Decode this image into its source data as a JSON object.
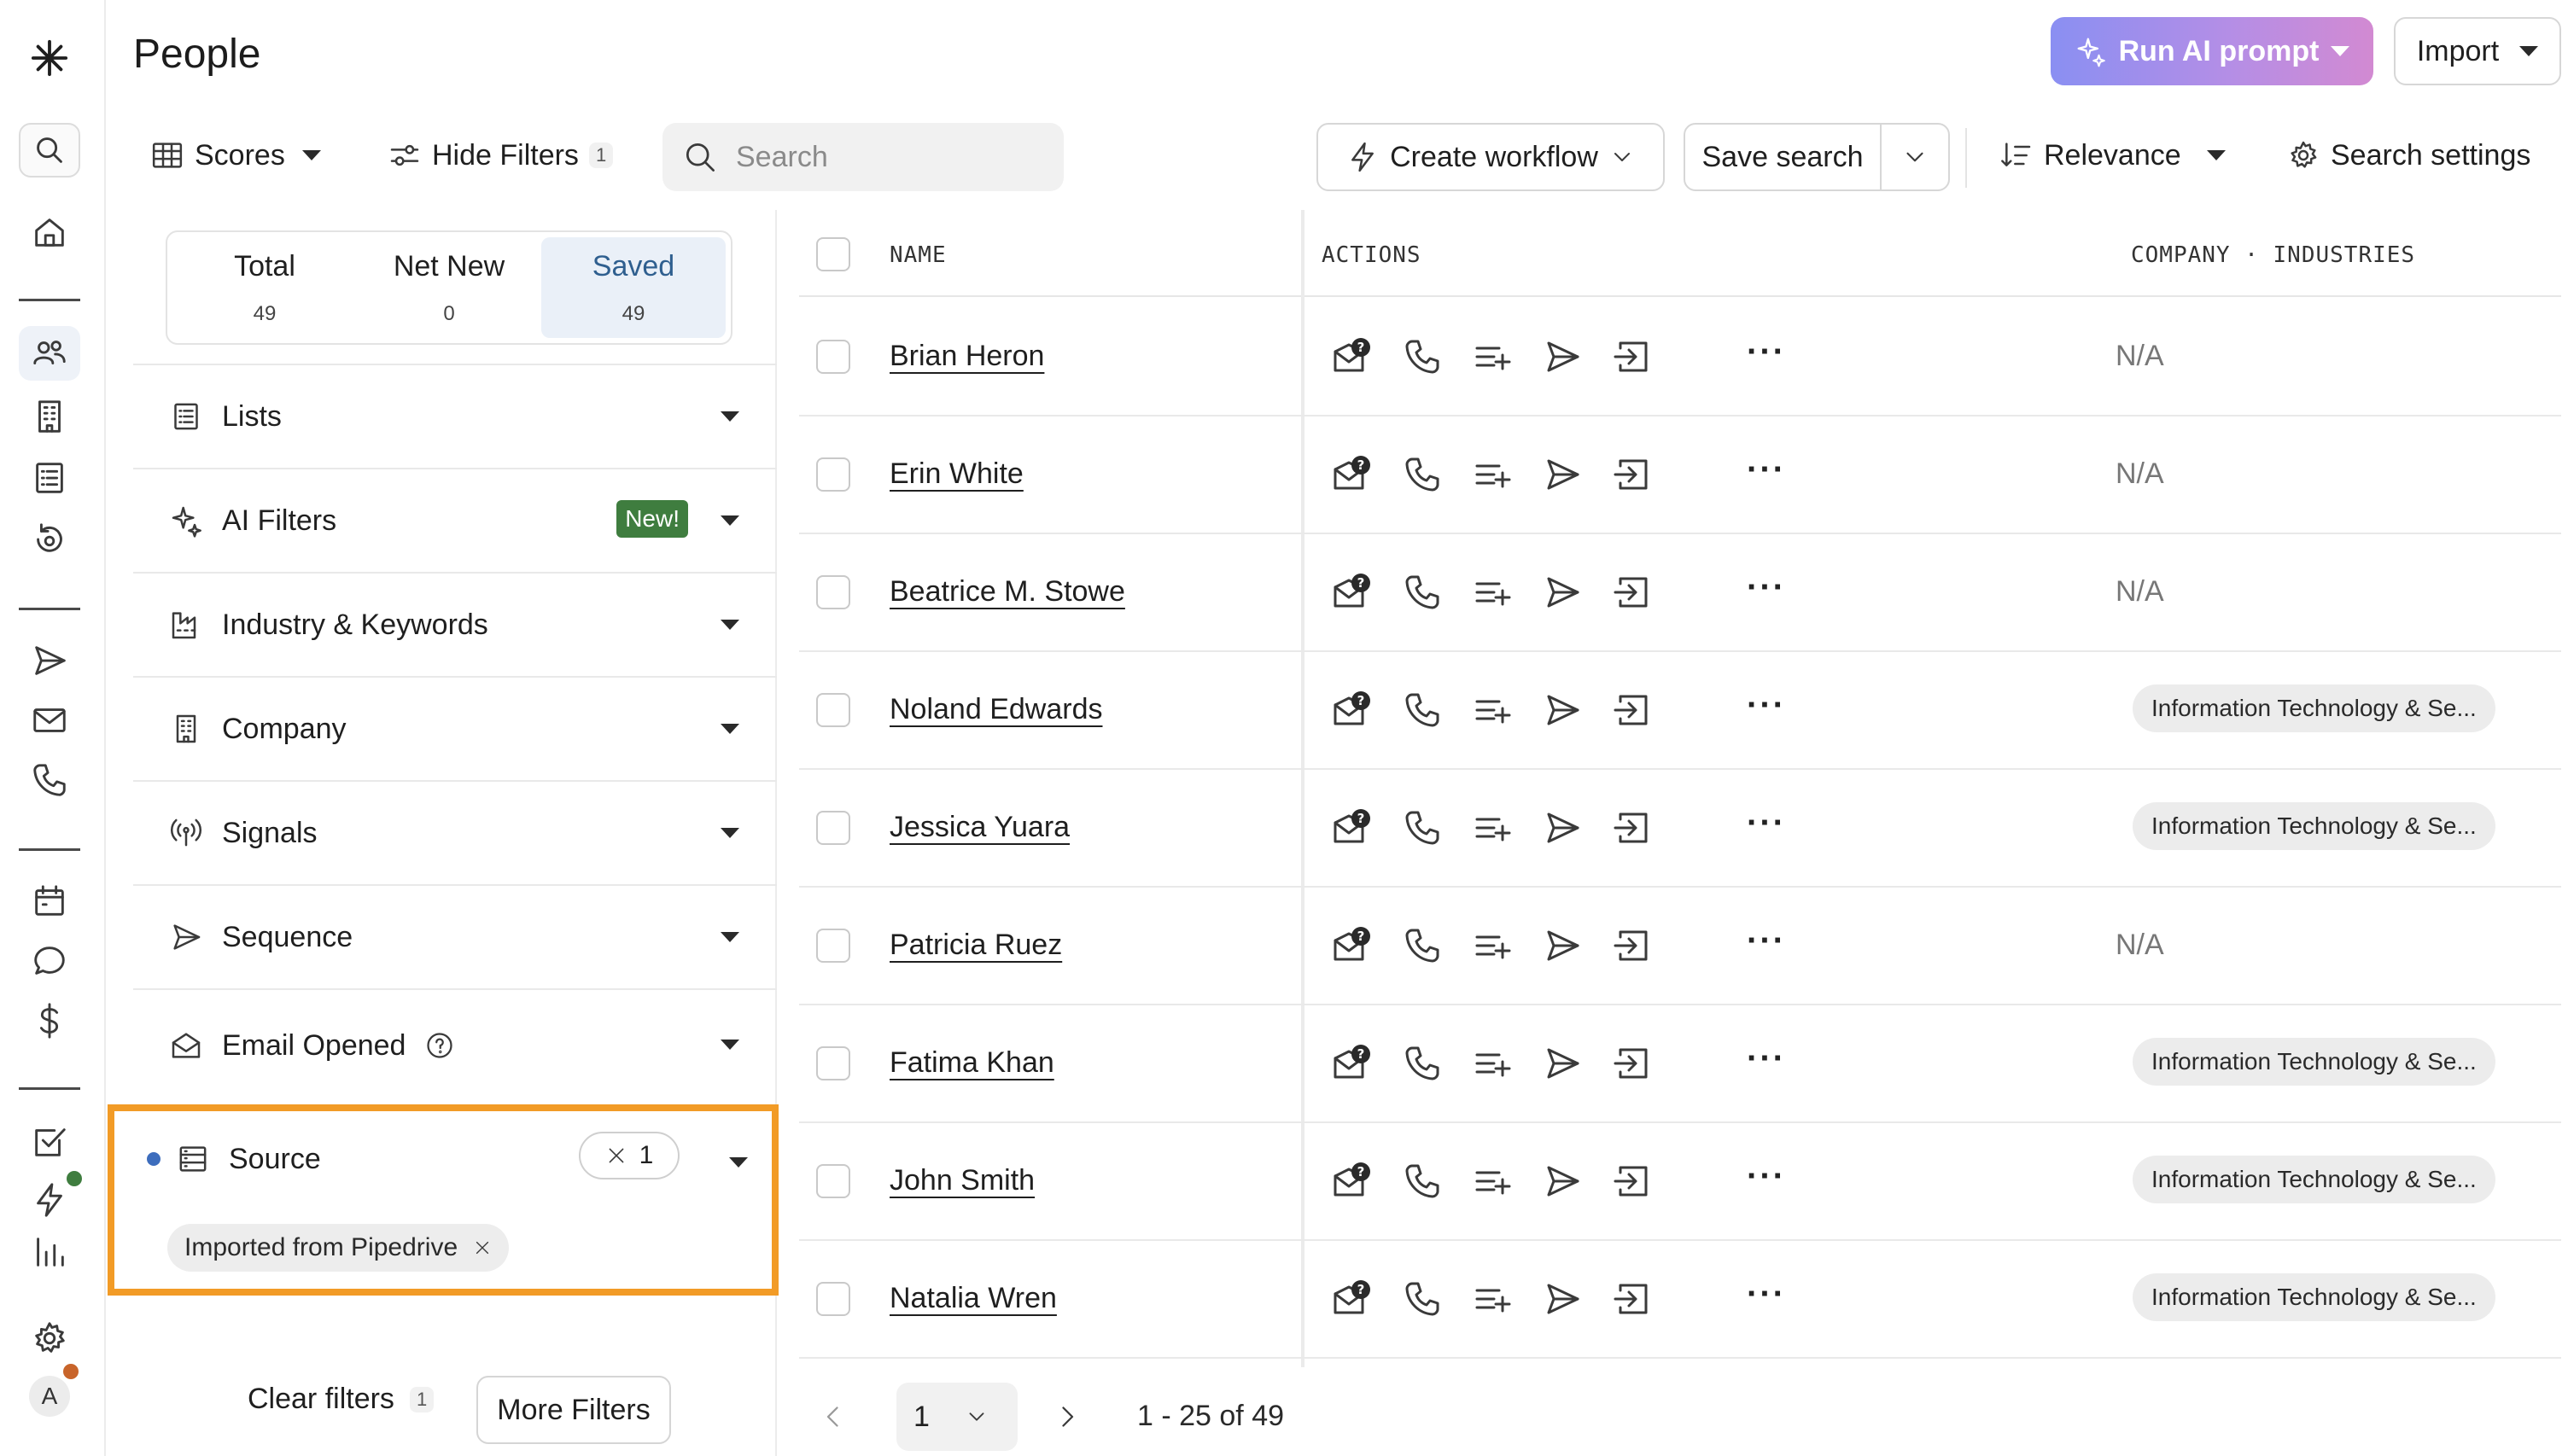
{
  "header": {
    "title": "People",
    "ai_button": "Run AI prompt",
    "import_button": "Import"
  },
  "toolbar": {
    "scores_label": "Scores",
    "hide_filters_label": "Hide Filters",
    "hide_filters_count": "1",
    "search_placeholder": "Search",
    "create_workflow_label": "Create workflow",
    "save_search_label": "Save search",
    "relevance_label": "Relevance",
    "search_settings_label": "Search settings"
  },
  "stats": [
    {
      "label": "Total",
      "count": "49"
    },
    {
      "label": "Net New",
      "count": "0"
    },
    {
      "label": "Saved",
      "count": "49"
    }
  ],
  "filters": {
    "items": [
      {
        "label": "Lists",
        "icon": "list-icon"
      },
      {
        "label": "AI Filters",
        "icon": "sparkle-icon",
        "badge": "New!"
      },
      {
        "label": "Industry & Keywords",
        "icon": "factory-icon"
      },
      {
        "label": "Company",
        "icon": "building-icon"
      },
      {
        "label": "Signals",
        "icon": "signal-icon"
      },
      {
        "label": "Sequence",
        "icon": "send-icon"
      },
      {
        "label": "Email Opened",
        "icon": "envelope-open-icon"
      }
    ],
    "source": {
      "label": "Source",
      "count": "1",
      "chip": "Imported from Pipedrive"
    },
    "clear_label": "Clear filters",
    "clear_count": "1",
    "more_label": "More Filters"
  },
  "table": {
    "columns": {
      "name": "NAME",
      "actions": "ACTIONS",
      "industries": "COMPANY · INDUSTRIES"
    },
    "rows": [
      {
        "name": "Brian Heron",
        "industry": "N/A"
      },
      {
        "name": "Erin White",
        "industry": "N/A"
      },
      {
        "name": "Beatrice M. Stowe",
        "industry": "N/A"
      },
      {
        "name": "Noland Edwards",
        "industry": "Information Technology & Se..."
      },
      {
        "name": "Jessica Yuara",
        "industry": "Information Technology & Se..."
      },
      {
        "name": "Patricia Ruez",
        "industry": "N/A"
      },
      {
        "name": "Fatima Khan",
        "industry": "Information Technology & Se..."
      },
      {
        "name": "John Smith",
        "industry": "Information Technology & Se..."
      },
      {
        "name": "Natalia Wren",
        "industry": "Information Technology & Se..."
      }
    ],
    "more_actions": "···"
  },
  "pagination": {
    "page": "1",
    "range": "1 - 25 of 49"
  },
  "rail": {
    "avatar": "A"
  },
  "colors": {
    "highlight": "#f29b26",
    "accent": "#2f5f8f",
    "new_badge": "#3f7d3f"
  }
}
